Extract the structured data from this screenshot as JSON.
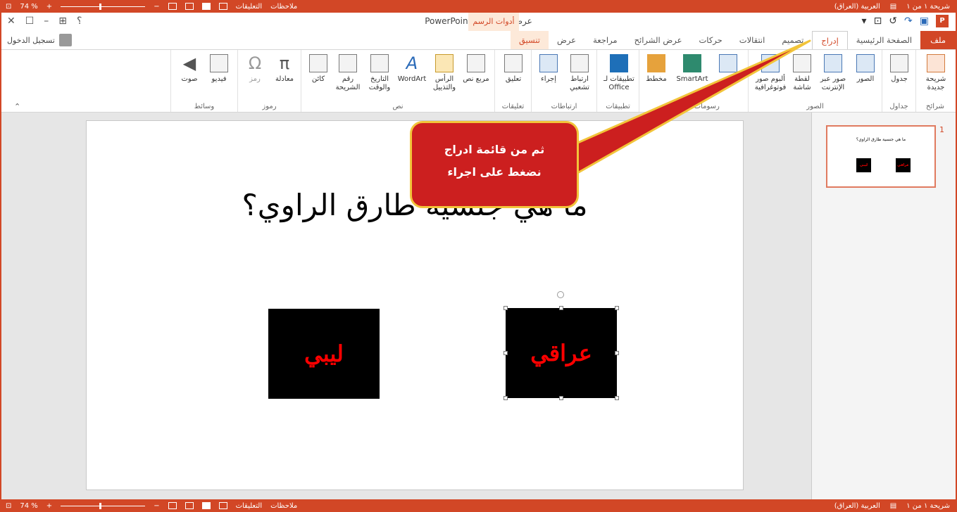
{
  "statusbar": {
    "zoom": "74 %",
    "comments": "التعليقات",
    "notes": "ملاحظات",
    "language": "العربية (العراق)",
    "slide_counter": "شريحة ١ من ١"
  },
  "titlebar": {
    "title": "عرض تقديمي١ - PowerPoint",
    "contextual_header": "أدوات الرسم",
    "help": "؟"
  },
  "tabs": {
    "file": "ملف",
    "home": "الصفحة الرئيسية",
    "insert": "إدراج",
    "design": "تصميم",
    "transitions": "انتقالات",
    "animations": "حركات",
    "slideshow": "عرض الشرائح",
    "review": "مراجعة",
    "view": "عرض",
    "format": "تنسيق"
  },
  "signin": "تسجيل الدخول",
  "ribbon": {
    "groups": {
      "slides": "شرائح",
      "tables": "جداول",
      "images": "الصور",
      "illustrations": "رسومات توضيحية",
      "apps": "تطبيقات",
      "links": "ارتباطات",
      "comments": "تعليقات",
      "text": "نص",
      "symbols": "رموز",
      "media": "وسائط"
    },
    "buttons": {
      "new_slide": "شريحة جديدة",
      "table": "جدول",
      "pictures": "الصور",
      "online_pictures": "صور عبر الإنترنت",
      "screenshot": "لقطة شاشة",
      "photo_album": "ألبوم صور فوتوغرافية",
      "smartart": "SmartArt",
      "chart": "مخطط",
      "apps_office": "تطبيقات لـ Office",
      "hyperlink": "ارتباط تشعبي",
      "action": "إجراء",
      "comment": "تعليق",
      "text_box": "مربع نص",
      "header_footer": "الرأس والتذييل",
      "wordart": "WordArt",
      "date_time": "التاريخ والوقت",
      "slide_number": "رقم الشريحة",
      "object": "كائن",
      "equation": "معادلة",
      "symbol": "رمز",
      "video": "فيديو",
      "audio": "صوت"
    }
  },
  "slide": {
    "title": "ما هي جنسية طارق الراوي؟",
    "option_1": "ليبي",
    "option_2": "عراقي"
  },
  "thumbnail": {
    "number": "1",
    "title": "ما هي جنسية طارق الراوي؟",
    "option_1": "ليبي",
    "option_2": "عراقي"
  },
  "callout": {
    "line1": "ثم من قائمة ادراج",
    "line2": "نضغط على اجراء"
  },
  "colors": {
    "accent": "#d24726",
    "callout_fill": "#cc1f1f",
    "callout_border": "#f2c43a",
    "answer_text": "#ff0000"
  }
}
